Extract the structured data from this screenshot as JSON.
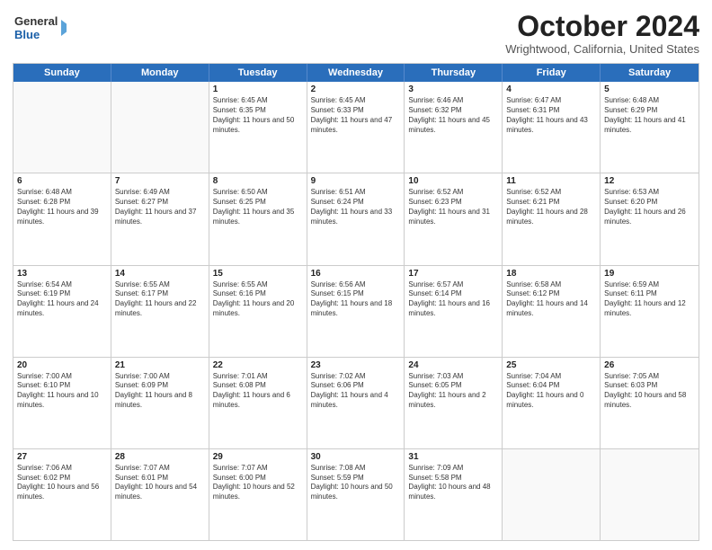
{
  "logo": {
    "line1": "General",
    "line2": "Blue"
  },
  "title": {
    "month_year": "October 2024",
    "location": "Wrightwood, California, United States"
  },
  "days_of_week": [
    "Sunday",
    "Monday",
    "Tuesday",
    "Wednesday",
    "Thursday",
    "Friday",
    "Saturday"
  ],
  "weeks": [
    [
      {
        "day": "",
        "info": ""
      },
      {
        "day": "",
        "info": ""
      },
      {
        "day": "1",
        "info": "Sunrise: 6:45 AM\nSunset: 6:35 PM\nDaylight: 11 hours and 50 minutes."
      },
      {
        "day": "2",
        "info": "Sunrise: 6:45 AM\nSunset: 6:33 PM\nDaylight: 11 hours and 47 minutes."
      },
      {
        "day": "3",
        "info": "Sunrise: 6:46 AM\nSunset: 6:32 PM\nDaylight: 11 hours and 45 minutes."
      },
      {
        "day": "4",
        "info": "Sunrise: 6:47 AM\nSunset: 6:31 PM\nDaylight: 11 hours and 43 minutes."
      },
      {
        "day": "5",
        "info": "Sunrise: 6:48 AM\nSunset: 6:29 PM\nDaylight: 11 hours and 41 minutes."
      }
    ],
    [
      {
        "day": "6",
        "info": "Sunrise: 6:48 AM\nSunset: 6:28 PM\nDaylight: 11 hours and 39 minutes."
      },
      {
        "day": "7",
        "info": "Sunrise: 6:49 AM\nSunset: 6:27 PM\nDaylight: 11 hours and 37 minutes."
      },
      {
        "day": "8",
        "info": "Sunrise: 6:50 AM\nSunset: 6:25 PM\nDaylight: 11 hours and 35 minutes."
      },
      {
        "day": "9",
        "info": "Sunrise: 6:51 AM\nSunset: 6:24 PM\nDaylight: 11 hours and 33 minutes."
      },
      {
        "day": "10",
        "info": "Sunrise: 6:52 AM\nSunset: 6:23 PM\nDaylight: 11 hours and 31 minutes."
      },
      {
        "day": "11",
        "info": "Sunrise: 6:52 AM\nSunset: 6:21 PM\nDaylight: 11 hours and 28 minutes."
      },
      {
        "day": "12",
        "info": "Sunrise: 6:53 AM\nSunset: 6:20 PM\nDaylight: 11 hours and 26 minutes."
      }
    ],
    [
      {
        "day": "13",
        "info": "Sunrise: 6:54 AM\nSunset: 6:19 PM\nDaylight: 11 hours and 24 minutes."
      },
      {
        "day": "14",
        "info": "Sunrise: 6:55 AM\nSunset: 6:17 PM\nDaylight: 11 hours and 22 minutes."
      },
      {
        "day": "15",
        "info": "Sunrise: 6:55 AM\nSunset: 6:16 PM\nDaylight: 11 hours and 20 minutes."
      },
      {
        "day": "16",
        "info": "Sunrise: 6:56 AM\nSunset: 6:15 PM\nDaylight: 11 hours and 18 minutes."
      },
      {
        "day": "17",
        "info": "Sunrise: 6:57 AM\nSunset: 6:14 PM\nDaylight: 11 hours and 16 minutes."
      },
      {
        "day": "18",
        "info": "Sunrise: 6:58 AM\nSunset: 6:12 PM\nDaylight: 11 hours and 14 minutes."
      },
      {
        "day": "19",
        "info": "Sunrise: 6:59 AM\nSunset: 6:11 PM\nDaylight: 11 hours and 12 minutes."
      }
    ],
    [
      {
        "day": "20",
        "info": "Sunrise: 7:00 AM\nSunset: 6:10 PM\nDaylight: 11 hours and 10 minutes."
      },
      {
        "day": "21",
        "info": "Sunrise: 7:00 AM\nSunset: 6:09 PM\nDaylight: 11 hours and 8 minutes."
      },
      {
        "day": "22",
        "info": "Sunrise: 7:01 AM\nSunset: 6:08 PM\nDaylight: 11 hours and 6 minutes."
      },
      {
        "day": "23",
        "info": "Sunrise: 7:02 AM\nSunset: 6:06 PM\nDaylight: 11 hours and 4 minutes."
      },
      {
        "day": "24",
        "info": "Sunrise: 7:03 AM\nSunset: 6:05 PM\nDaylight: 11 hours and 2 minutes."
      },
      {
        "day": "25",
        "info": "Sunrise: 7:04 AM\nSunset: 6:04 PM\nDaylight: 11 hours and 0 minutes."
      },
      {
        "day": "26",
        "info": "Sunrise: 7:05 AM\nSunset: 6:03 PM\nDaylight: 10 hours and 58 minutes."
      }
    ],
    [
      {
        "day": "27",
        "info": "Sunrise: 7:06 AM\nSunset: 6:02 PM\nDaylight: 10 hours and 56 minutes."
      },
      {
        "day": "28",
        "info": "Sunrise: 7:07 AM\nSunset: 6:01 PM\nDaylight: 10 hours and 54 minutes."
      },
      {
        "day": "29",
        "info": "Sunrise: 7:07 AM\nSunset: 6:00 PM\nDaylight: 10 hours and 52 minutes."
      },
      {
        "day": "30",
        "info": "Sunrise: 7:08 AM\nSunset: 5:59 PM\nDaylight: 10 hours and 50 minutes."
      },
      {
        "day": "31",
        "info": "Sunrise: 7:09 AM\nSunset: 5:58 PM\nDaylight: 10 hours and 48 minutes."
      },
      {
        "day": "",
        "info": ""
      },
      {
        "day": "",
        "info": ""
      }
    ]
  ]
}
